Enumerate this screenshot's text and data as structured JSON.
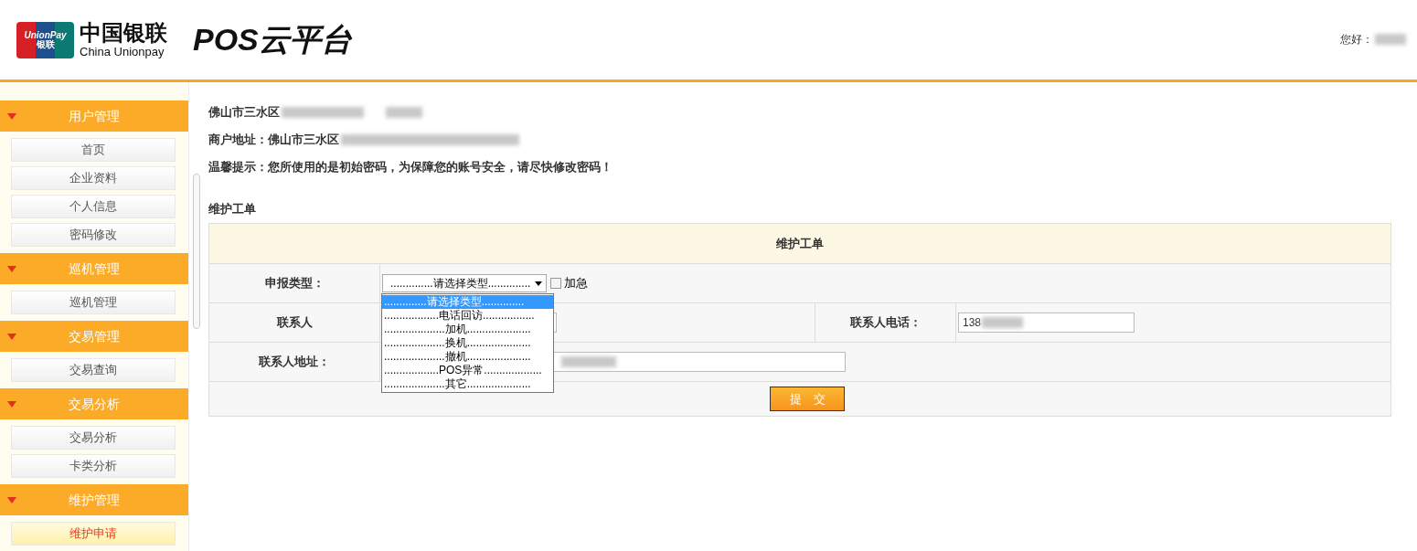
{
  "header": {
    "logo_badge_top": "UnionPay",
    "logo_badge_bottom": "银联",
    "logo_cn": "中国银联",
    "logo_en": "China Unionpay",
    "app_title": "POS云平台",
    "greeting": "您好："
  },
  "sidebar": {
    "groups": [
      {
        "title": "用户管理",
        "expanded": true,
        "items": [
          {
            "label": "首页",
            "selected": false
          },
          {
            "label": "企业资料",
            "selected": false
          },
          {
            "label": "个人信息",
            "selected": false
          },
          {
            "label": "密码修改",
            "selected": false
          }
        ]
      },
      {
        "title": "巡机管理",
        "expanded": true,
        "items": [
          {
            "label": "巡机管理",
            "selected": false
          }
        ]
      },
      {
        "title": "交易管理",
        "expanded": true,
        "items": [
          {
            "label": "交易查询",
            "selected": false
          }
        ]
      },
      {
        "title": "交易分析",
        "expanded": true,
        "items": [
          {
            "label": "交易分析",
            "selected": false
          },
          {
            "label": "卡类分析",
            "selected": false
          }
        ]
      },
      {
        "title": "维护管理",
        "expanded": true,
        "items": [
          {
            "label": "维护申请",
            "selected": true
          }
        ]
      }
    ]
  },
  "info": {
    "merchant_name": "佛山市三水区",
    "merchant_address": "商户地址：佛山市三水区",
    "notice": "温馨提示：您所使用的是初始密码，为保障您的账号安全，请尽快修改密码！"
  },
  "section_title": "维护工单",
  "form": {
    "title": "维护工单",
    "type_label": "申报类型：",
    "type_value": "..............请选择类型..............",
    "type_options": [
      {
        "label": "..............请选择类型..............",
        "selected": true
      },
      {
        "label": "..................电话回访.................",
        "selected": false
      },
      {
        "label": "....................加机.....................",
        "selected": false
      },
      {
        "label": "....................换机.....................",
        "selected": false
      },
      {
        "label": "....................撤机.....................",
        "selected": false
      },
      {
        "label": "..................POS异常...................",
        "selected": false
      },
      {
        "label": "....................其它.....................",
        "selected": false
      }
    ],
    "urgent": {
      "label": "加急",
      "checked": false
    },
    "contact_label": "联系人",
    "phone_label": "联系人电话：",
    "phone_value": "138",
    "address_label": "联系人地址：",
    "submit": "提　交"
  }
}
